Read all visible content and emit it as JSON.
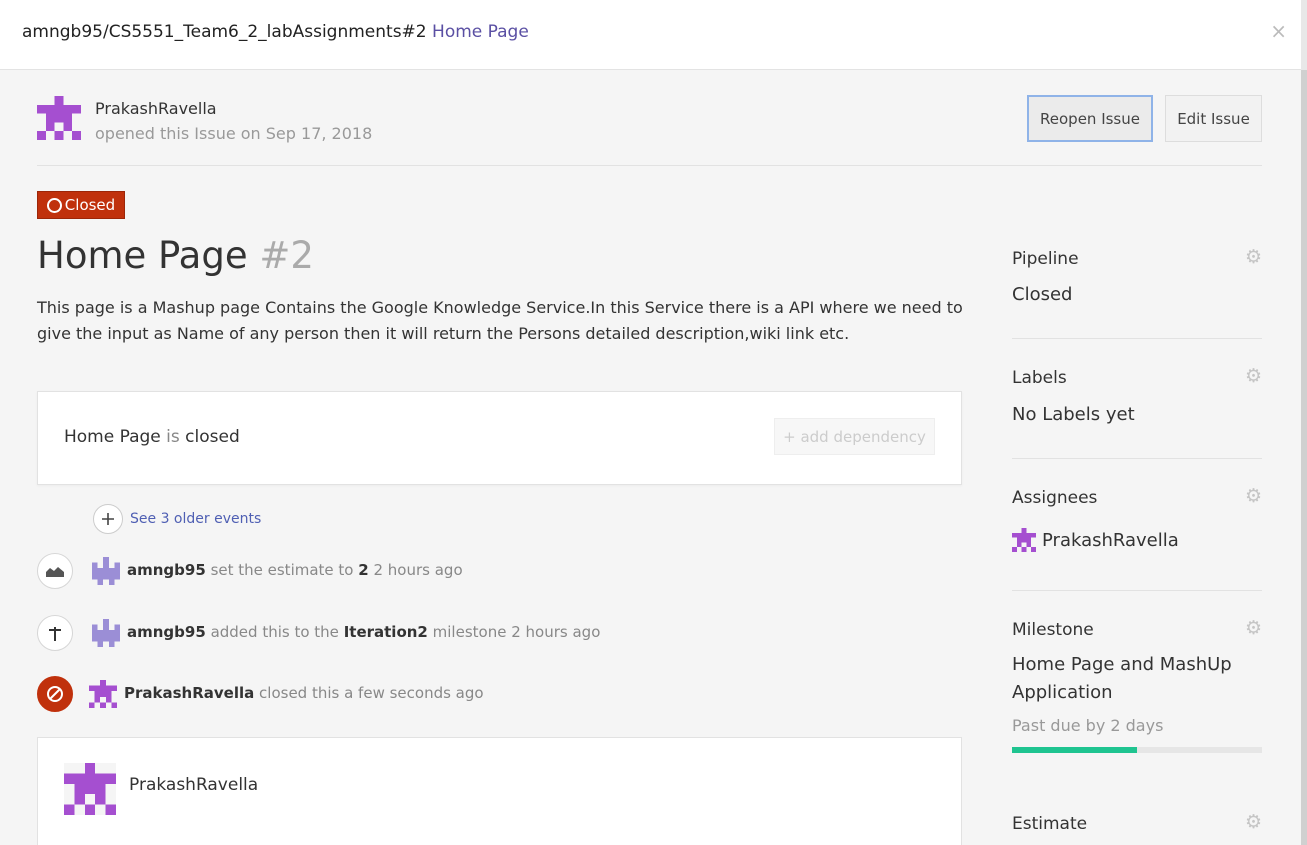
{
  "header": {
    "repo": "amngb95/CS5551_Team6_2_labAssignments#2",
    "issue_title": "Home Page",
    "close_symbol": "×"
  },
  "opener": {
    "name": "PrakashRavella",
    "meta": "opened this Issue on Sep 17, 2018"
  },
  "actions": {
    "reopen_label": "Reopen Issue",
    "edit_label": "Edit Issue"
  },
  "issue": {
    "status_badge": "Closed",
    "title": "Home Page",
    "number": "#2",
    "description": "This page is a Mashup page Contains the Google Knowledge Service.In this Service there is a API where we need to give the input as Name of any person then it will return the Persons detailed description,wiki link etc."
  },
  "dependency": {
    "issue_name": "Home Page",
    "is_text": "is",
    "state": "closed",
    "add_label": "+ add dependency"
  },
  "timeline": {
    "older_events": "See 3 older events",
    "events": [
      {
        "icon": "estimate-icon",
        "user": "amngb95",
        "action": "set the estimate to",
        "value": "2",
        "time": "2 hours ago"
      },
      {
        "icon": "milestone-signpost-icon",
        "user": "amngb95",
        "action": "added this to the",
        "value": "Iteration2",
        "suffix": "milestone",
        "time": "2 hours ago"
      },
      {
        "icon": "closed-icon",
        "user": "PrakashRavella",
        "action": "closed this a few seconds ago"
      }
    ]
  },
  "comment": {
    "author": "PrakashRavella"
  },
  "sidebar": {
    "pipeline": {
      "title": "Pipeline",
      "value": "Closed"
    },
    "labels": {
      "title": "Labels",
      "value": "No Labels yet"
    },
    "assignees": {
      "title": "Assignees",
      "value": "PrakashRavella"
    },
    "milestone": {
      "title": "Milestone",
      "value_line1": "Home Page and MashUp",
      "value_line2": "Application",
      "due": "Past due by 2 days",
      "progress": 0.5
    },
    "estimate": {
      "title": "Estimate"
    }
  },
  "colors": {
    "accent": "#5a4fa3",
    "closed_red": "#c0310c",
    "progress_green": "#1fc490",
    "avatar_purple": "#a54fd0",
    "avatar_lavender": "#9b8ed6"
  }
}
